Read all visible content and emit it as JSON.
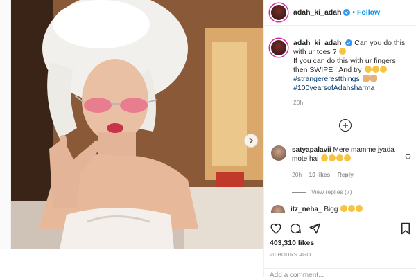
{
  "post": {
    "username": "adah_ki_adah",
    "follow_label": "Follow",
    "dot": "•"
  },
  "caption": {
    "username": "adah_ki_adah",
    "line1": "Can you do this with ur toes ?",
    "line2": "If you can do this with ur fingers then SWIPE ! And try",
    "hashtag1": "#strangererestthings",
    "hashtag2": "#100yearsofAdahsharma",
    "time": "20h"
  },
  "comments": [
    {
      "username": "satyapalavii",
      "text": "Mere mamme jyada mote hai",
      "time": "20h",
      "likes": "10 likes",
      "reply": "Reply",
      "view_replies": "View replies (7)"
    },
    {
      "username": "itz_neha_",
      "text": "Bigg"
    }
  ],
  "actions": {
    "likes": "403,310 likes",
    "ago": "20 HOURS AGO",
    "add_comment_placeholder": "Add a comment..."
  },
  "icons": [
    "heart-icon",
    "comment-icon",
    "share-icon",
    "bookmark-icon",
    "next-arrow-icon",
    "load-more-icon",
    "verified-icon"
  ],
  "colors": {
    "link_blue": "#0095f6",
    "hashtag_blue": "#00376b",
    "muted": "#8e8e8e",
    "verified": "#3897f0"
  }
}
